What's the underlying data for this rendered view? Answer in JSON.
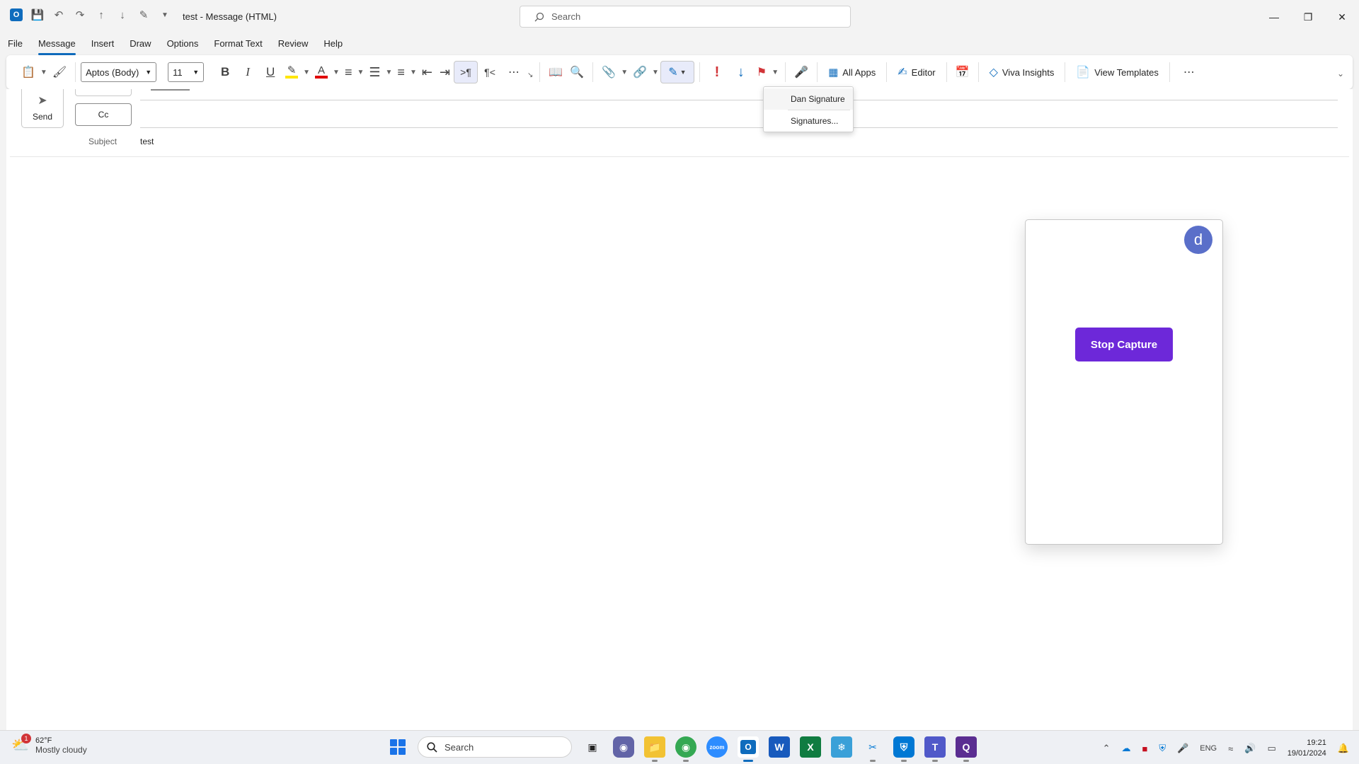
{
  "window": {
    "title": "test  -  Message (HTML)",
    "search_placeholder": "Search"
  },
  "menu": {
    "tabs": [
      "File",
      "Message",
      "Insert",
      "Draw",
      "Options",
      "Format Text",
      "Review",
      "Help"
    ],
    "active": "Message"
  },
  "ribbon": {
    "font_name": "Aptos (Body)",
    "font_size": "11",
    "all_apps_label": "All Apps",
    "editor_label": "Editor",
    "viva_label": "Viva Insights",
    "templates_label": "View Templates",
    "highlight_color": "#ffe600",
    "font_color": "#e00000"
  },
  "signature_menu": {
    "items": [
      "Dan Signature",
      "Signatures..."
    ]
  },
  "compose": {
    "send_label": "Send",
    "cc_label": "Cc",
    "subject_label": "Subject",
    "subject_value": "test"
  },
  "panel": {
    "avatar_letter": "d",
    "stop_label": "Stop Capture",
    "stop_color": "#6d28d9"
  },
  "taskbar": {
    "weather_temp": "62°F",
    "weather_desc": "Mostly cloudy",
    "weather_badge": "1",
    "search_placeholder": "Search",
    "language": "ENG",
    "time": "19:21",
    "date": "19/01/2024"
  }
}
